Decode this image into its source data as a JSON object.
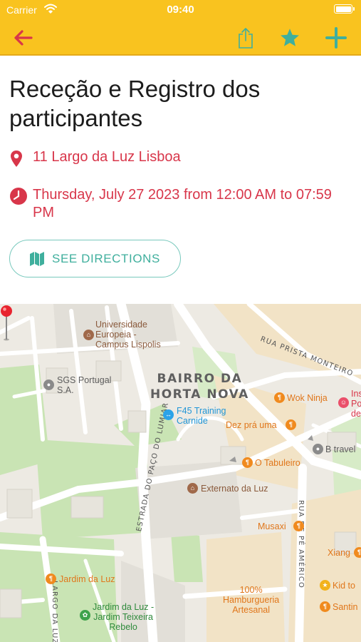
{
  "status_bar": {
    "carrier": "Carrier",
    "time": "09:40"
  },
  "toolbar": {
    "back_icon": "arrow-left-icon",
    "share_icon": "share-icon",
    "favorite_icon": "star-icon",
    "add_icon": "plus-icon",
    "colors": {
      "bar": "#F9C31F",
      "back": "#D8364A",
      "actions": "#3FAF9D"
    }
  },
  "event": {
    "title": "Receção e Registro dos participantes",
    "location": "11 Largo da Luz Lisboa",
    "datetime": "Thursday, July 27 2023 from 12:00 AM to 07:59 PM",
    "accent_color": "#D8364A"
  },
  "directions_button": {
    "label": "SEE DIRECTIONS",
    "icon": "map-icon"
  },
  "map": {
    "district": [
      "BAIRRO DA",
      "HORTA NOVA"
    ],
    "streets": {
      "prista": "RUA PRISTA MONTEIRO",
      "paco": "ESTRADA DO PAÇO DO LUMIAR",
      "pe_americo": "RUA DE PÉ AMÉRICO",
      "largo": "LARGO DA LUZ"
    },
    "pois": {
      "univ": "Universidade\nEuropeia -\nCampus Lispolis",
      "sgs": "SGS Portugal\nS.A.",
      "f45": "F45 Training\nCarnide",
      "wok": "Wok Ninja",
      "ins": "Ins\nPo\nde",
      "dez": "Dez prá uma",
      "btravel": "B travel",
      "tabuleiro": "O Tabuleiro",
      "externato": "Externato da Luz",
      "musaxi": "Musaxi",
      "xiang": "Xiang",
      "hamburgueria": "100%\nHamburgueria\nArtesanal",
      "kid": "Kid to",
      "santin": "Santin",
      "jardim": "Jardim da Luz",
      "teixeira": "Jardim da Luz -\nJardim Teixeira\nRebelo"
    }
  }
}
